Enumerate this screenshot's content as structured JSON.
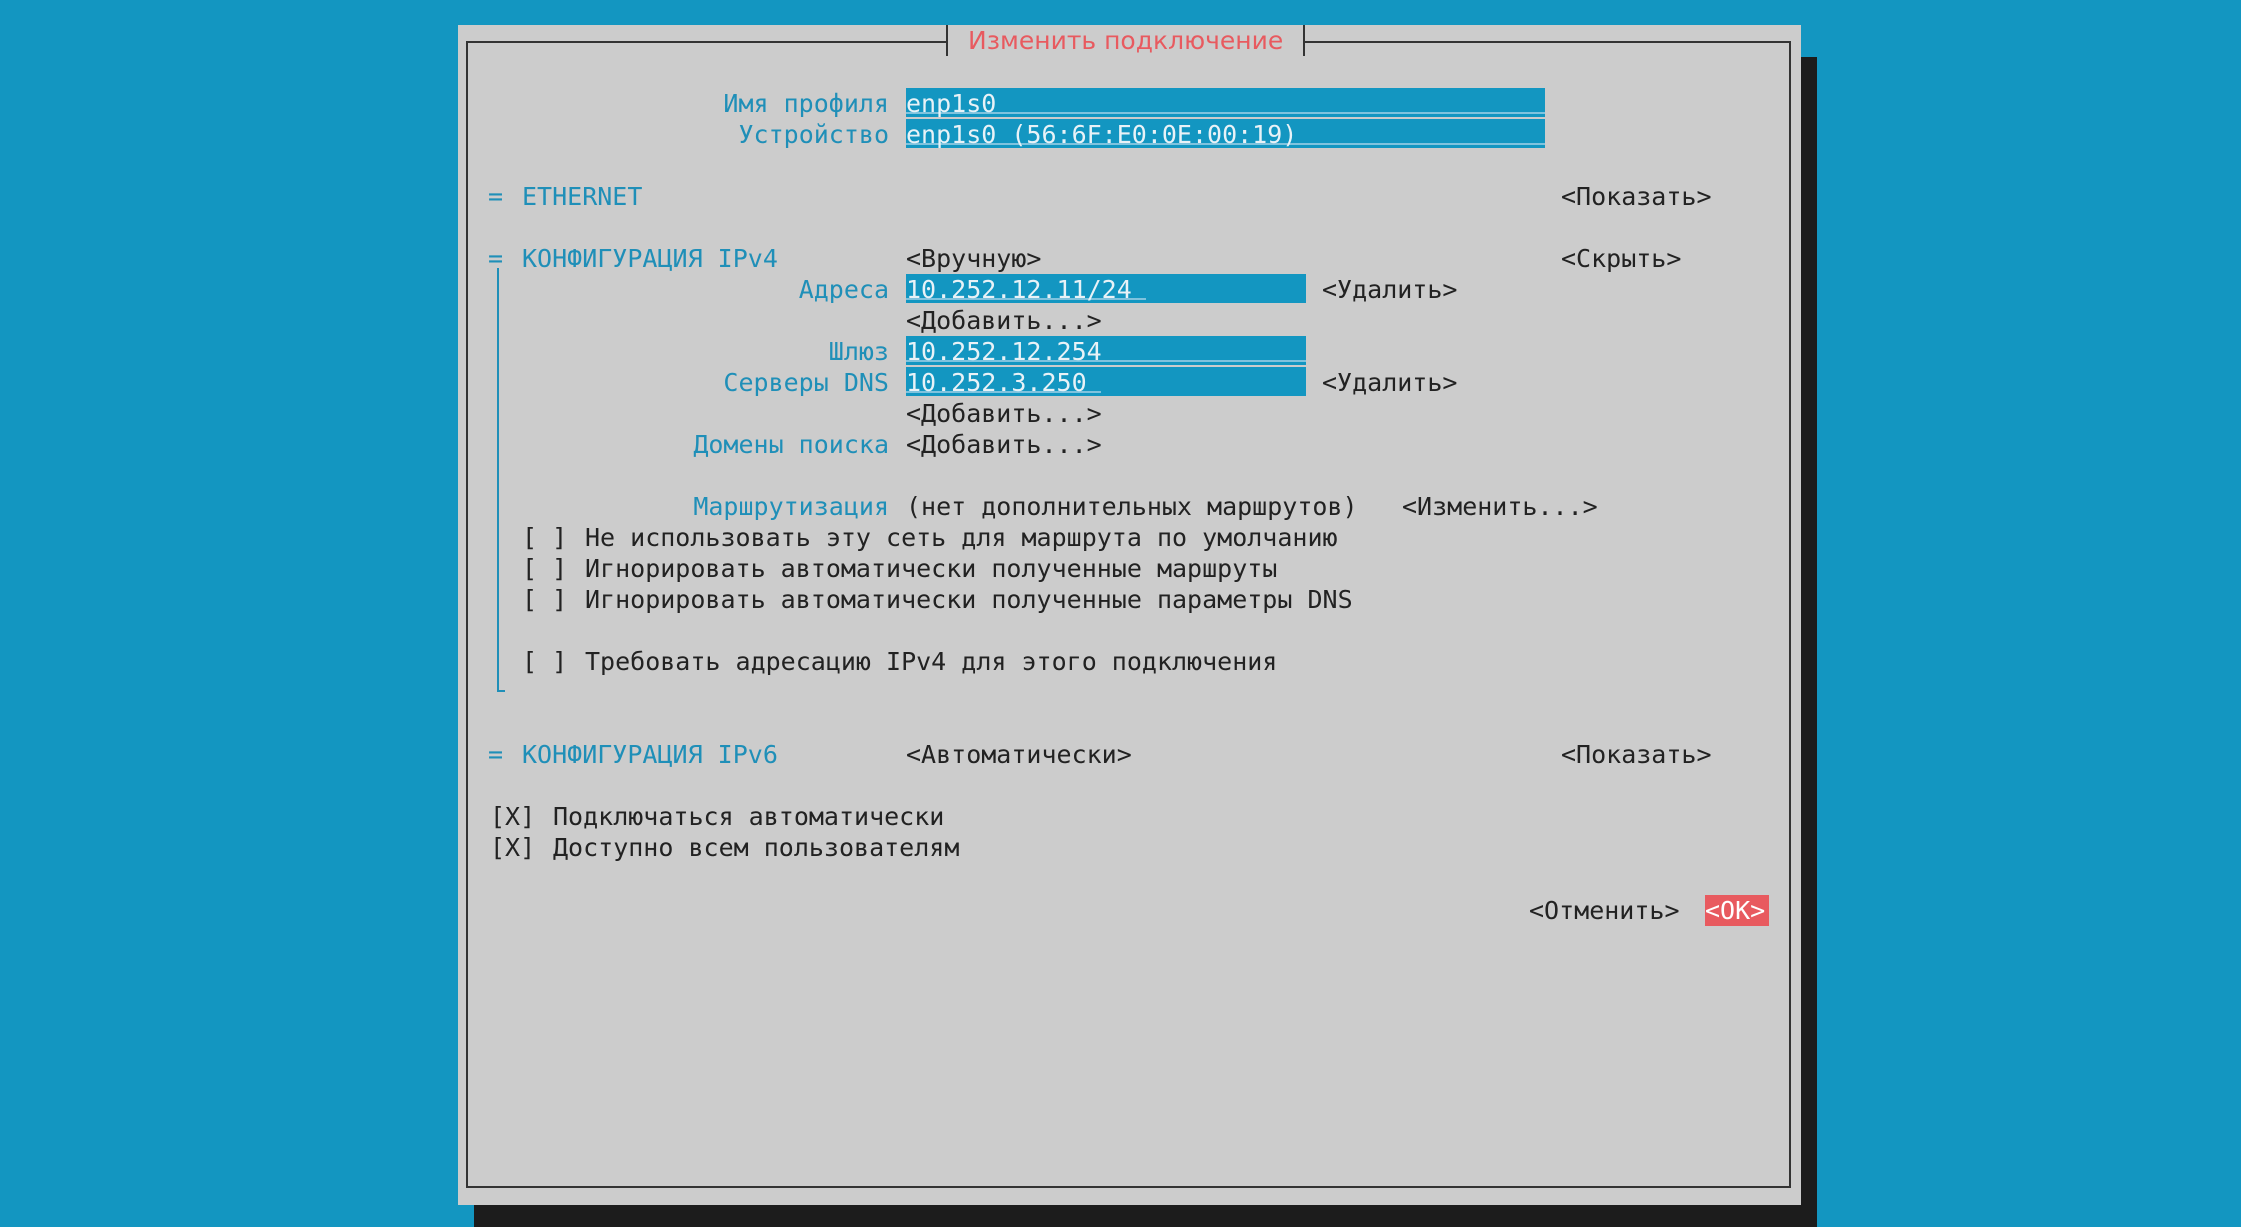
{
  "dialog": {
    "title": "Изменить подключение"
  },
  "profile": {
    "name_label": "Имя профиля",
    "name_value": "enp1s0",
    "device_label": "Устройство",
    "device_value": "enp1s0 (56:6F:E0:0E:00:19)"
  },
  "ethernet": {
    "marker": "=",
    "title": "ETHERNET",
    "toggle": "<Показать>"
  },
  "ipv4": {
    "marker": "=",
    "title": "КОНФИГУРАЦИЯ IPv4",
    "mode": "<Вручную>",
    "toggle": "<Скрыть>",
    "addresses_label": "Адреса",
    "address_value": "10.252.12.11/24",
    "address_remove": "<Удалить>",
    "address_add": "<Добавить...>",
    "gateway_label": "Шлюз",
    "gateway_value": "10.252.12.254",
    "dns_label": "Серверы DNS",
    "dns_value": "10.252.3.250",
    "dns_remove": "<Удалить>",
    "dns_add": "<Добавить...>",
    "search_label": "Домены поиска",
    "search_add": "<Добавить...>",
    "routing_label": "Маршрутизация",
    "routing_value": "(нет дополнительных маршрутов)",
    "routing_edit": "<Изменить...>",
    "checkboxes": [
      {
        "mark": "[ ]",
        "label": "Не использовать эту сеть для маршрута по умолчанию"
      },
      {
        "mark": "[ ]",
        "label": "Игнорировать автоматически полученные маршруты"
      },
      {
        "mark": "[ ]",
        "label": "Игнорировать автоматически полученные параметры DNS"
      },
      {
        "mark": "[ ]",
        "label": "Требовать адресацию IPv4 для этого подключения"
      }
    ]
  },
  "ipv6": {
    "marker": "=",
    "title": "КОНФИГУРАЦИЯ IPv6",
    "mode": "<Автоматически>",
    "toggle": "<Показать>"
  },
  "general": [
    {
      "mark": "[X]",
      "label": "Подключаться автоматически"
    },
    {
      "mark": "[X]",
      "label": "Доступно всем пользователям"
    }
  ],
  "actions": {
    "cancel": "<Отменить>",
    "ok": "<OK>"
  },
  "colors": {
    "background": "#1396c1",
    "dialog": "#cccccc",
    "accent": "#1f8fb8",
    "title": "#e85a5f",
    "ok_bg": "#e85a5f"
  }
}
